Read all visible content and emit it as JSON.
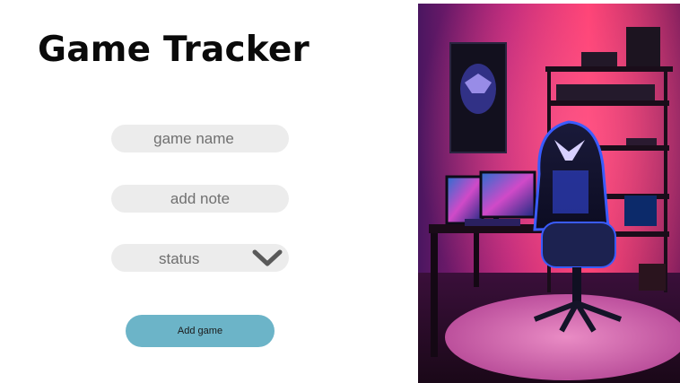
{
  "app": {
    "title": "Game Tracker"
  },
  "form": {
    "game_name_placeholder": "game name",
    "add_note_placeholder": "add note",
    "status_selected": "status",
    "add_button_label": "Add game"
  },
  "icons": {
    "status_dropdown": "chevron-down-icon"
  },
  "colors": {
    "input_background": "#ececec",
    "button_background": "#6cb4c8",
    "title_text": "#0a0a0a",
    "image_accent_pink": "#ff2d8a",
    "image_accent_purple": "#5a1e7a"
  }
}
